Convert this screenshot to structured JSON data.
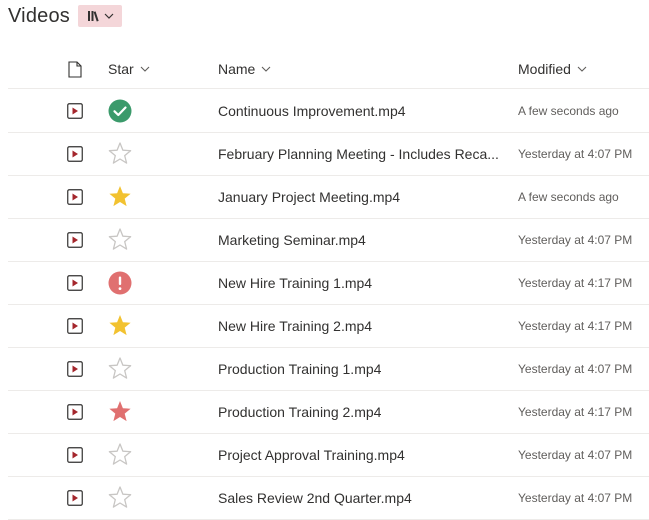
{
  "header": {
    "title": "Videos"
  },
  "columns": {
    "star": "Star",
    "name": "Name",
    "modified": "Modified"
  },
  "colors": {
    "accent": "#a4262c",
    "view_button_bg": "#f4d6d9",
    "green": "#3b9a6b",
    "gold": "#f2c230",
    "red": "#e07070",
    "empty_star": "#c8c6c4"
  },
  "rows": [
    {
      "name": "Continuous Improvement.mp4",
      "modified": "A few seconds ago",
      "star": "check-circle"
    },
    {
      "name": "February Planning Meeting - Includes Reca...",
      "modified": "Yesterday at 4:07 PM",
      "star": "empty"
    },
    {
      "name": "January Project Meeting.mp4",
      "modified": "A few seconds ago",
      "star": "gold"
    },
    {
      "name": "Marketing Seminar.mp4",
      "modified": "Yesterday at 4:07 PM",
      "star": "empty"
    },
    {
      "name": "New Hire Training 1.mp4",
      "modified": "Yesterday at 4:17 PM",
      "star": "exclamation-circle"
    },
    {
      "name": "New Hire Training 2.mp4",
      "modified": "Yesterday at 4:17 PM",
      "star": "gold"
    },
    {
      "name": "Production Training 1.mp4",
      "modified": "Yesterday at 4:07 PM",
      "star": "empty"
    },
    {
      "name": "Production Training 2.mp4",
      "modified": "Yesterday at 4:17 PM",
      "star": "red"
    },
    {
      "name": "Project Approval Training.mp4",
      "modified": "Yesterday at 4:07 PM",
      "star": "empty"
    },
    {
      "name": "Sales Review 2nd Quarter.mp4",
      "modified": "Yesterday at 4:07 PM",
      "star": "empty"
    }
  ]
}
